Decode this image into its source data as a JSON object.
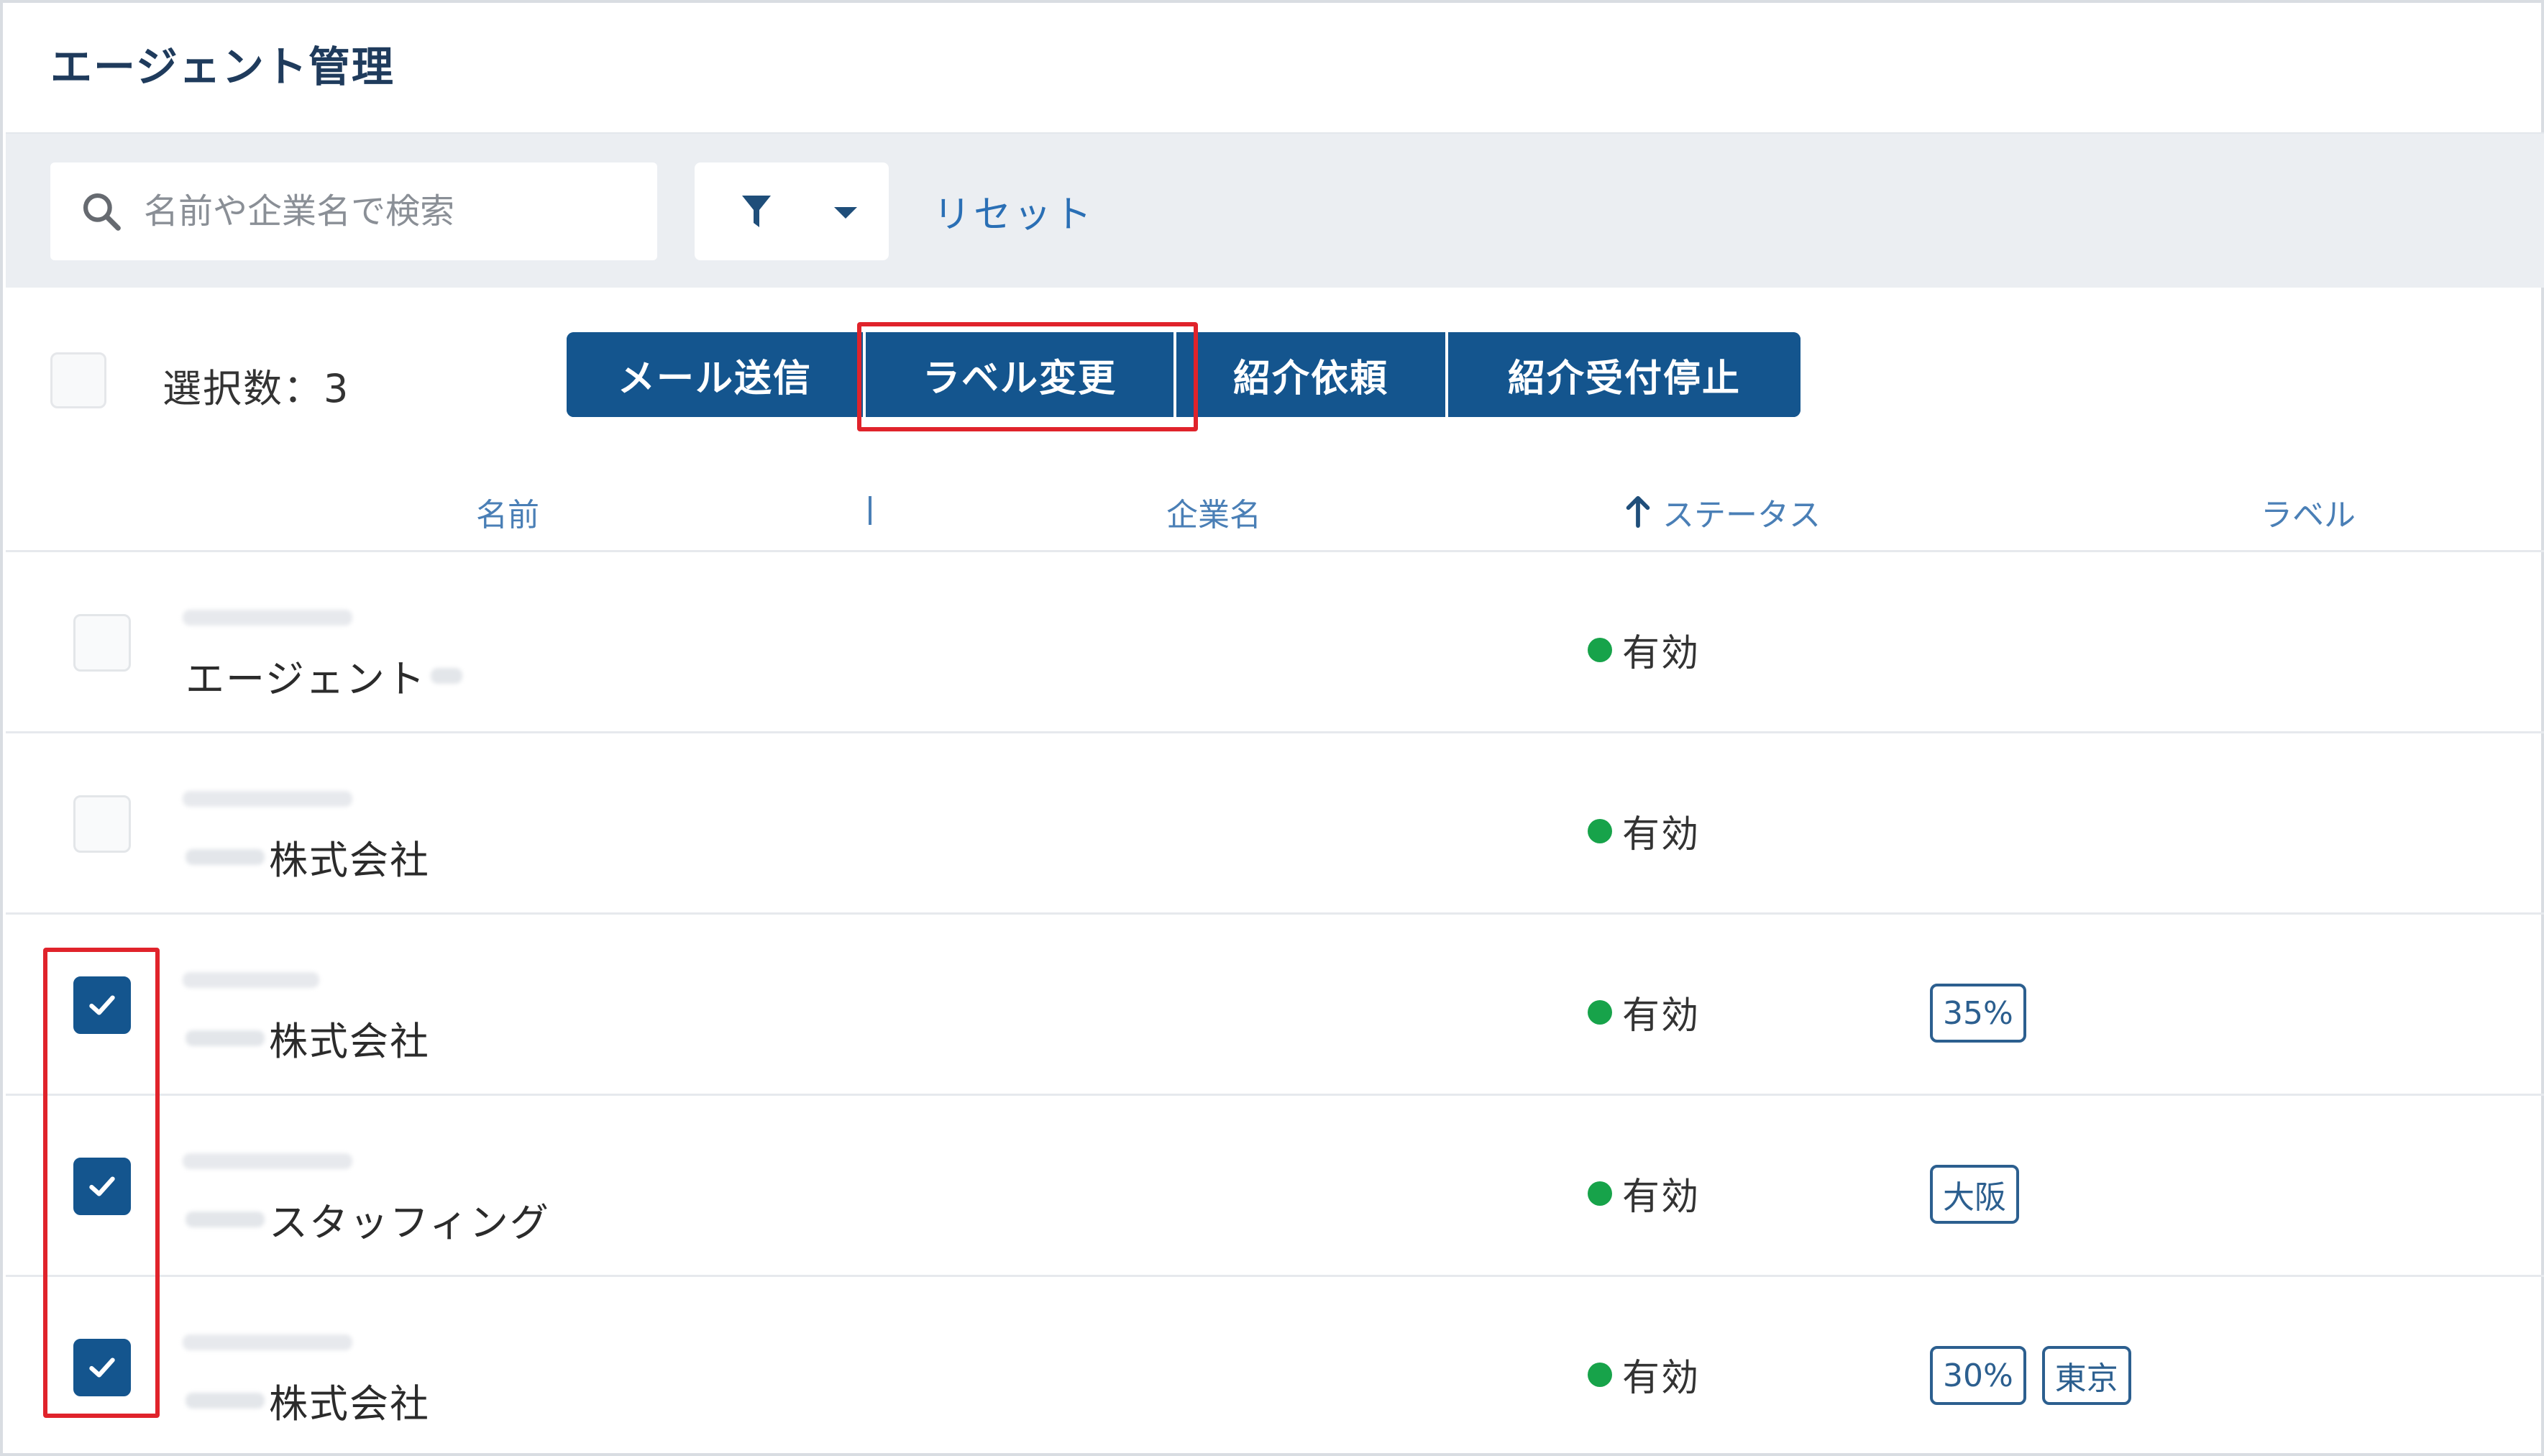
{
  "page": {
    "title": "エージェント管理"
  },
  "filter_bar": {
    "search_placeholder": "名前や企業名で検索",
    "search_icon": "search-icon",
    "filter_icon": "filter-icon",
    "dropdown_icon": "caret-down-icon",
    "reset_label": "リセット"
  },
  "bulk": {
    "selected_count_label": "選択数：3",
    "buttons": {
      "mail": "メール送信",
      "label_change": "ラベル変更",
      "intro_request": "紹介依頼",
      "intro_stop": "紹介受付停止"
    }
  },
  "columns": {
    "name": "名前",
    "company": "企業名",
    "status": "ステータス",
    "label": "ラベル",
    "sort_icon": "arrow-up-icon"
  },
  "rows": [
    {
      "checked": false,
      "name_suffix": "エージェント",
      "status": "有効",
      "tags": []
    },
    {
      "checked": false,
      "name_suffix": "株式会社",
      "status": "有効",
      "tags": []
    },
    {
      "checked": true,
      "name_suffix": "株式会社",
      "status": "有効",
      "tags": [
        "35%"
      ]
    },
    {
      "checked": true,
      "name_suffix": "スタッフィング",
      "status": "有効",
      "tags": [
        "大阪"
      ]
    },
    {
      "checked": true,
      "name_suffix": "株式会社",
      "status": "有効",
      "tags": [
        "30%",
        "東京"
      ]
    }
  ],
  "colors": {
    "primary": "#14558e",
    "link": "#2a6fb5",
    "status_active": "#17a34a",
    "highlight": "#e0232b"
  }
}
